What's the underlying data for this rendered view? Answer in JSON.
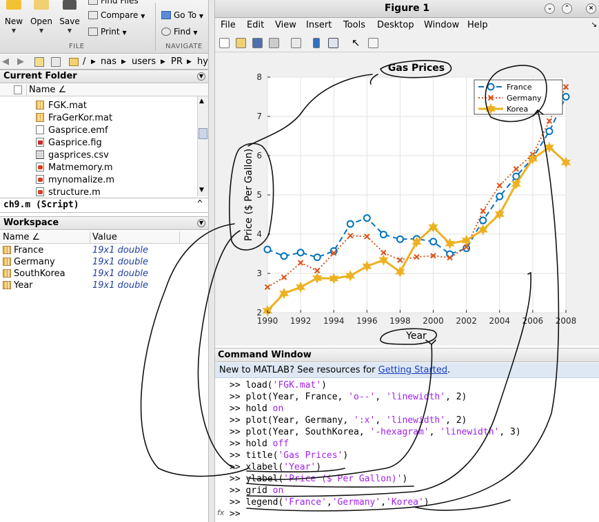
{
  "toolstrip": {
    "new_label": "New",
    "open_label": "Open",
    "save_label": "Save",
    "find_files_label": "Find Files",
    "compare_label": "Compare",
    "print_label": "Print",
    "goto_label": "Go To",
    "find_label": "Find",
    "file_section": "FILE",
    "navigate_section": "NAVIGATE"
  },
  "address": {
    "path": [
      "/",
      "nas",
      "users",
      "PR",
      "hyun"
    ]
  },
  "current_folder": {
    "title": "Current Folder",
    "name_column": "Name ∠",
    "files": [
      {
        "name": "FGK.mat",
        "type": "mat"
      },
      {
        "name": "FraGerKor.mat",
        "type": "mat"
      },
      {
        "name": "Gasprice.emf",
        "type": "emf"
      },
      {
        "name": "Gasprice.fig",
        "type": "fig"
      },
      {
        "name": "gasprices.csv",
        "type": "csv"
      },
      {
        "name": "Matmemory.m",
        "type": "m"
      },
      {
        "name": "mynomalize.m",
        "type": "m"
      },
      {
        "name": "structure.m",
        "type": "m"
      }
    ]
  },
  "script_bar": {
    "label": "ch9.m  (Script)"
  },
  "workspace": {
    "title": "Workspace",
    "name_column": "Name ∠",
    "value_column": "Value",
    "vars": [
      {
        "name": "France",
        "value": "19x1 double"
      },
      {
        "name": "Germany",
        "value": "19x1 double"
      },
      {
        "name": "SouthKorea",
        "value": "19x1 double"
      },
      {
        "name": "Year",
        "value": "19x1 double"
      }
    ]
  },
  "figure": {
    "window_title": "Figure 1",
    "menu": [
      "File",
      "Edit",
      "View",
      "Insert",
      "Tools",
      "Desktop",
      "Window",
      "Help"
    ]
  },
  "chart_data": {
    "type": "line",
    "title": "Gas Prices",
    "xlabel": "Year",
    "ylabel": "Price ($ Per Gallon)",
    "xlim": [
      1990,
      2008
    ],
    "ylim": [
      2,
      8
    ],
    "xticks": [
      1990,
      1992,
      1994,
      1996,
      1998,
      2000,
      2002,
      2004,
      2006,
      2008
    ],
    "yticks": [
      2,
      3,
      4,
      5,
      6,
      7,
      8
    ],
    "grid": true,
    "legend_position": "top-right",
    "x": [
      1990,
      1991,
      1992,
      1993,
      1994,
      1995,
      1996,
      1997,
      1998,
      1999,
      2000,
      2001,
      2002,
      2003,
      2004,
      2005,
      2006,
      2007,
      2008
    ],
    "series": [
      {
        "name": "France",
        "style": "dashed-circle",
        "color": "#0072bd",
        "values": [
          3.61,
          3.44,
          3.53,
          3.41,
          3.57,
          4.26,
          4.41,
          3.99,
          3.87,
          3.88,
          3.81,
          3.49,
          3.64,
          4.35,
          4.96,
          5.47,
          5.94,
          6.62,
          7.5
        ]
      },
      {
        "name": "Germany",
        "style": "dotted-x",
        "color": "#d95319",
        "values": [
          2.65,
          2.9,
          3.27,
          3.07,
          3.52,
          3.96,
          3.94,
          3.53,
          3.34,
          3.42,
          3.45,
          3.4,
          3.67,
          4.59,
          5.24,
          5.66,
          6.03,
          6.88,
          7.75
        ]
      },
      {
        "name": "Korea",
        "style": "solid-hexagram",
        "color": "#edb120",
        "values": [
          2.05,
          2.49,
          2.65,
          2.88,
          2.87,
          2.94,
          3.18,
          3.34,
          3.04,
          3.8,
          4.18,
          3.76,
          3.84,
          4.11,
          4.51,
          5.28,
          5.92,
          6.21,
          5.83
        ]
      }
    ]
  },
  "command_window": {
    "title": "Command Window",
    "notice_prefix": "New to MATLAB? See resources for ",
    "notice_link": "Getting Started",
    "notice_suffix": ".",
    "lines": [
      [
        ">> load(",
        "'FGK.mat'",
        ")"
      ],
      [
        ">> plot(Year, France, ",
        "'o--'",
        ", ",
        "'linewidth'",
        ", 2)"
      ],
      [
        ">> hold ",
        "on"
      ],
      [
        ">> plot(Year, Germany, ",
        "':x'",
        ", ",
        "'linewidth'",
        ", 2)"
      ],
      [
        ">> plot(Year, SouthKorea, ",
        "'-hexagram'",
        ", ",
        "'linewidth'",
        ", 3)"
      ],
      [
        ">> hold ",
        "off"
      ],
      [
        ">> title(",
        "'Gas Prices'",
        ")"
      ],
      [
        ">> xlabel(",
        "'Year'",
        ")"
      ],
      [
        ">> ylabel(",
        "'Price ($ Per Gallon)'",
        ")"
      ],
      [
        ">> grid ",
        "on"
      ],
      [
        ">> legend(",
        "'France'",
        ",",
        "'Germany'",
        ",",
        "'Korea'",
        ")"
      ],
      [
        ">> "
      ]
    ],
    "fx": "fx"
  }
}
